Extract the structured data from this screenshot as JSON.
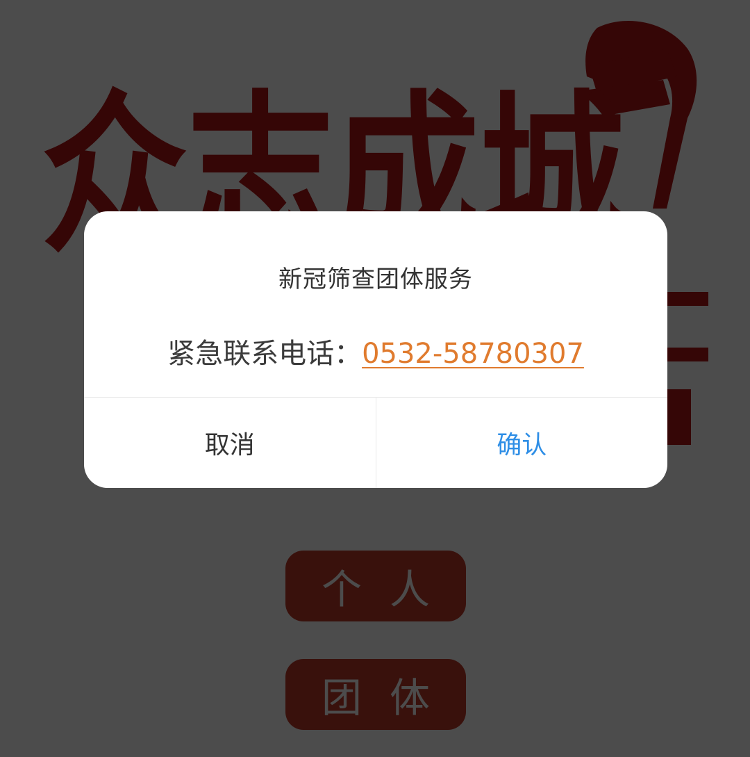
{
  "banner": {
    "slogan": "众志成城",
    "accent_color": "#b31414"
  },
  "role_buttons": {
    "personal_label": "个人",
    "group_label": "团体",
    "color": "#c0392b"
  },
  "dialog": {
    "title": "新冠筛查团体服务",
    "contact_label": "紧急联系电话：",
    "phone": "0532-58780307",
    "cancel_label": "取消",
    "confirm_label": "确认",
    "confirm_color": "#2e8ee6",
    "phone_color": "#e07b2e"
  }
}
